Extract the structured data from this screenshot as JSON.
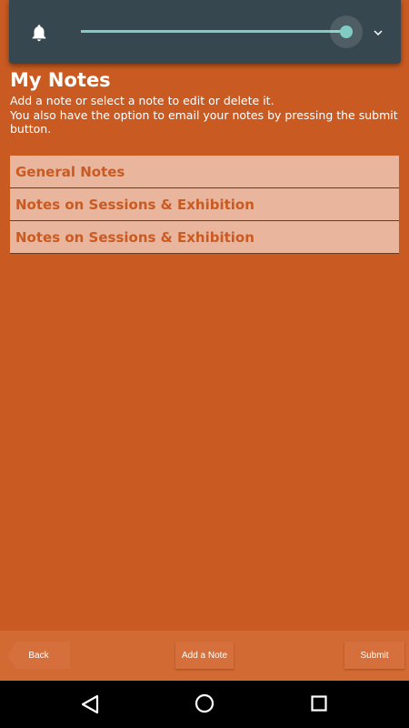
{
  "volume_panel": {
    "level_percent": 100,
    "icons": [
      "bell-icon",
      "chevron-down-icon"
    ],
    "accent_color": "#80cbc4"
  },
  "page": {
    "title": "My Notes",
    "description_line1": "Add a note or select a note to edit or delete it.",
    "description_line2": "You also have the option to email your notes by pressing the submit button."
  },
  "notes": [
    {
      "label": "General Notes"
    },
    {
      "label": "Notes on Sessions & Exhibition"
    },
    {
      "label": "Notes on Sessions & Exhibition"
    }
  ],
  "toolbar": {
    "back_label": "Back",
    "add_label": "Add a Note",
    "submit_label": "Submit"
  },
  "nav_bar": {
    "icons": [
      "back-triangle-icon",
      "home-circle-icon",
      "recents-square-icon"
    ]
  },
  "colors": {
    "background": "#c95b22",
    "list_item_bg": "#e9b59c",
    "list_item_text": "#c95b22"
  }
}
